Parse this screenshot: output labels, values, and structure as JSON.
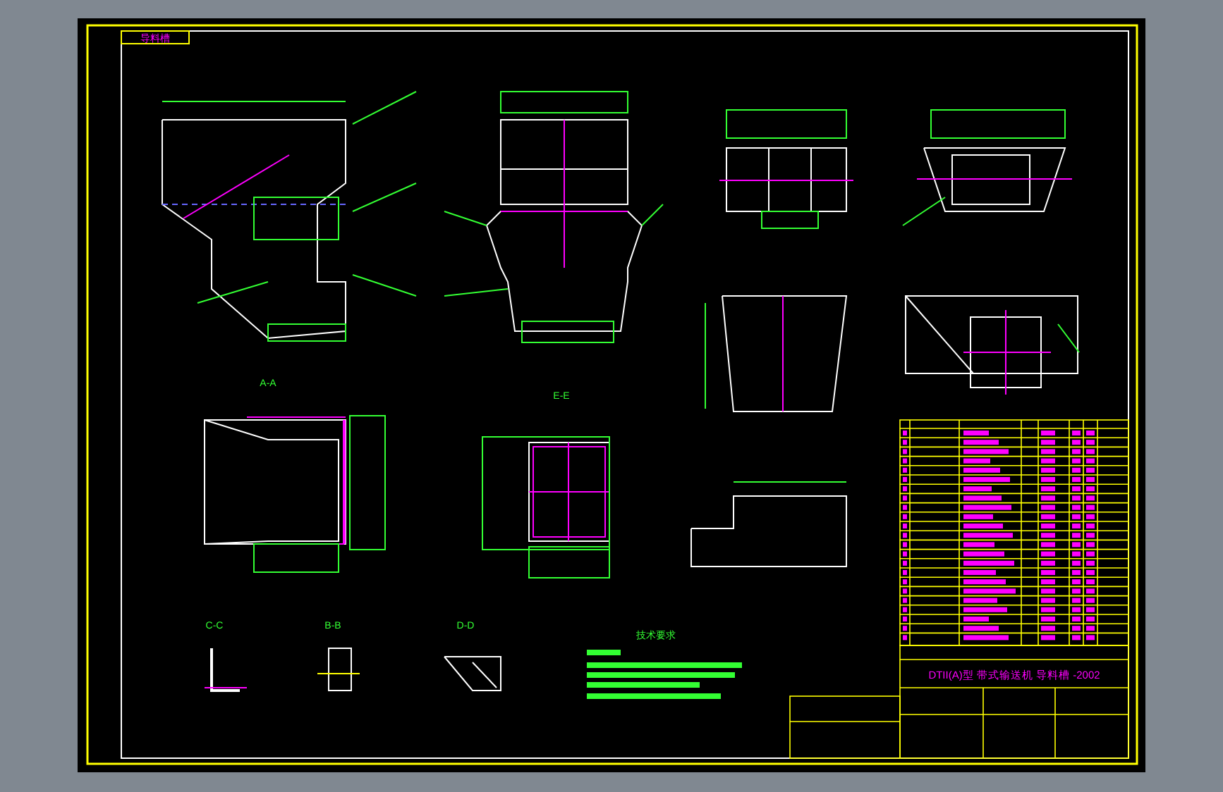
{
  "sheet": {
    "tab": "导料槽",
    "section_labels": [
      {
        "text": "A-A"
      },
      {
        "text": "E-E"
      },
      {
        "text": "C-C"
      },
      {
        "text": "B-B"
      },
      {
        "text": "D-D"
      }
    ],
    "notes_title": "技术要求",
    "title_block": {
      "title": "DTII(A)型 带式输送机 导料槽 -2002"
    }
  }
}
